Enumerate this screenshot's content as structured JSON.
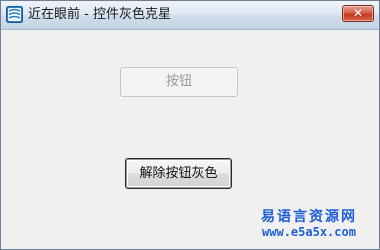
{
  "window": {
    "title": "近在眼前 - 控件灰色克星",
    "icon": "app-icon",
    "close_label": "✕"
  },
  "buttons": {
    "disabled_button_label": "按钮",
    "enable_button_label": "解除按钮灰色"
  },
  "watermark": {
    "chinese": "易语言资源网",
    "url": "www.e5a5x.com"
  },
  "colors": {
    "title_gradient_top": "#eef3f9",
    "title_gradient_bottom": "#c4d3e6",
    "close_button": "#c23a20",
    "client_background": "#f0f0f0",
    "watermark": "#1f5fd6"
  }
}
